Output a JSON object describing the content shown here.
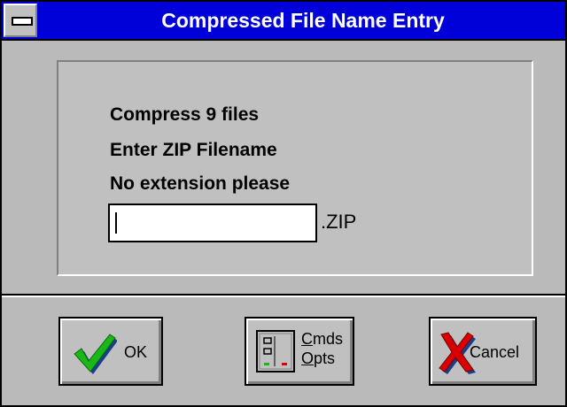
{
  "window": {
    "title": "Compressed File Name Entry"
  },
  "message": {
    "line1": "Compress 9 files",
    "line2": "Enter ZIP Filename",
    "line3": "No extension please"
  },
  "filename_input": {
    "value": "",
    "suffix": ".ZIP"
  },
  "buttons": {
    "ok": {
      "label": "OK"
    },
    "cmds_opts": {
      "line1_accel": "C",
      "line1_rest": "mds",
      "line2_accel": "O",
      "line2_rest": "pts"
    },
    "cancel": {
      "label": "Cancel"
    }
  },
  "icons": {
    "system_menu": "system-menu-icon",
    "ok": "green-checkmark-icon",
    "cmds_opts": "panel-options-icon",
    "cancel": "red-x-icon"
  },
  "colors": {
    "titlebar": "#0000d8",
    "face": "#c0c0c0",
    "check": "#18b818",
    "cancel_x": "#d80000"
  }
}
